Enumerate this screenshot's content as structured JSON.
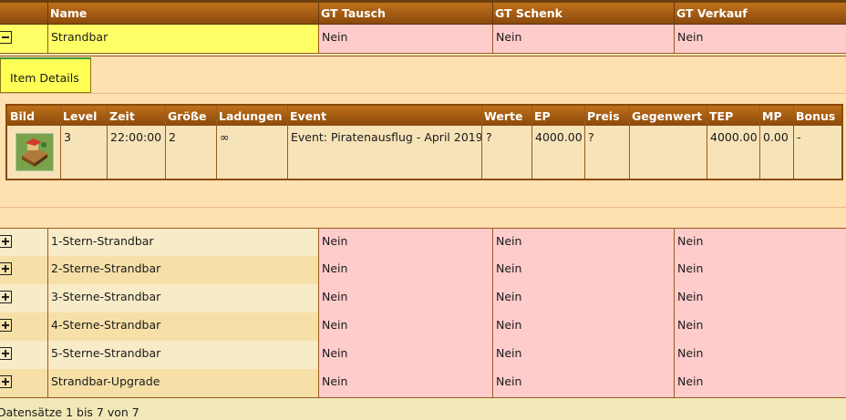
{
  "columns": {
    "name": "Name",
    "gt_tausch": "GT Tausch",
    "gt_schenk": "GT Schenk",
    "gt_verkauf": "GT Verkauf"
  },
  "expanded_row": {
    "name": "Strandbar",
    "gt_tausch": "Nein",
    "gt_schenk": "Nein",
    "gt_verkauf": "Nein",
    "row_color": "#ffff66"
  },
  "item_details_label": "Item Details",
  "detail_columns": [
    "Bild",
    "Level",
    "Zeit",
    "Größe",
    "Ladungen",
    "Event",
    "Werte",
    "EP",
    "Preis",
    "Gegenwert",
    "TEP",
    "MP",
    "Bonus"
  ],
  "detail_row": {
    "level": "3",
    "zeit": "22:00:00",
    "groesse": "2",
    "ladungen": "∞",
    "event": "Event: Piratenausflug - April 2019",
    "werte": "?",
    "ep": "4000.00",
    "preis": "?",
    "gegenwert": "",
    "tep": "4000.00",
    "mp": "0.00",
    "bonus": "-",
    "image_icon": "beach-bar-icon"
  },
  "rows": [
    {
      "name": "1-Stern-Strandbar",
      "gt_tausch": "Nein",
      "gt_schenk": "Nein",
      "gt_verkauf": "Nein"
    },
    {
      "name": "2-Sterne-Strandbar",
      "gt_tausch": "Nein",
      "gt_schenk": "Nein",
      "gt_verkauf": "Nein"
    },
    {
      "name": "3-Sterne-Strandbar",
      "gt_tausch": "Nein",
      "gt_schenk": "Nein",
      "gt_verkauf": "Nein"
    },
    {
      "name": "4-Sterne-Strandbar",
      "gt_tausch": "Nein",
      "gt_schenk": "Nein",
      "gt_verkauf": "Nein"
    },
    {
      "name": "5-Sterne-Strandbar",
      "gt_tausch": "Nein",
      "gt_schenk": "Nein",
      "gt_verkauf": "Nein"
    },
    {
      "name": "Strandbar-Upgrade",
      "gt_tausch": "Nein",
      "gt_schenk": "Nein",
      "gt_verkauf": "Nein"
    }
  ],
  "footer": "Datensätze 1 bis 7 von 7",
  "colors": {
    "header_top": "#c0701a",
    "header_bottom": "#8a4a0c",
    "gt_cell": "#ffcccc",
    "row_odd": "#f7ebc8",
    "row_even": "#f7e0a8",
    "detail_bg": "#ffe0b0",
    "item_button": "#ffff55"
  }
}
